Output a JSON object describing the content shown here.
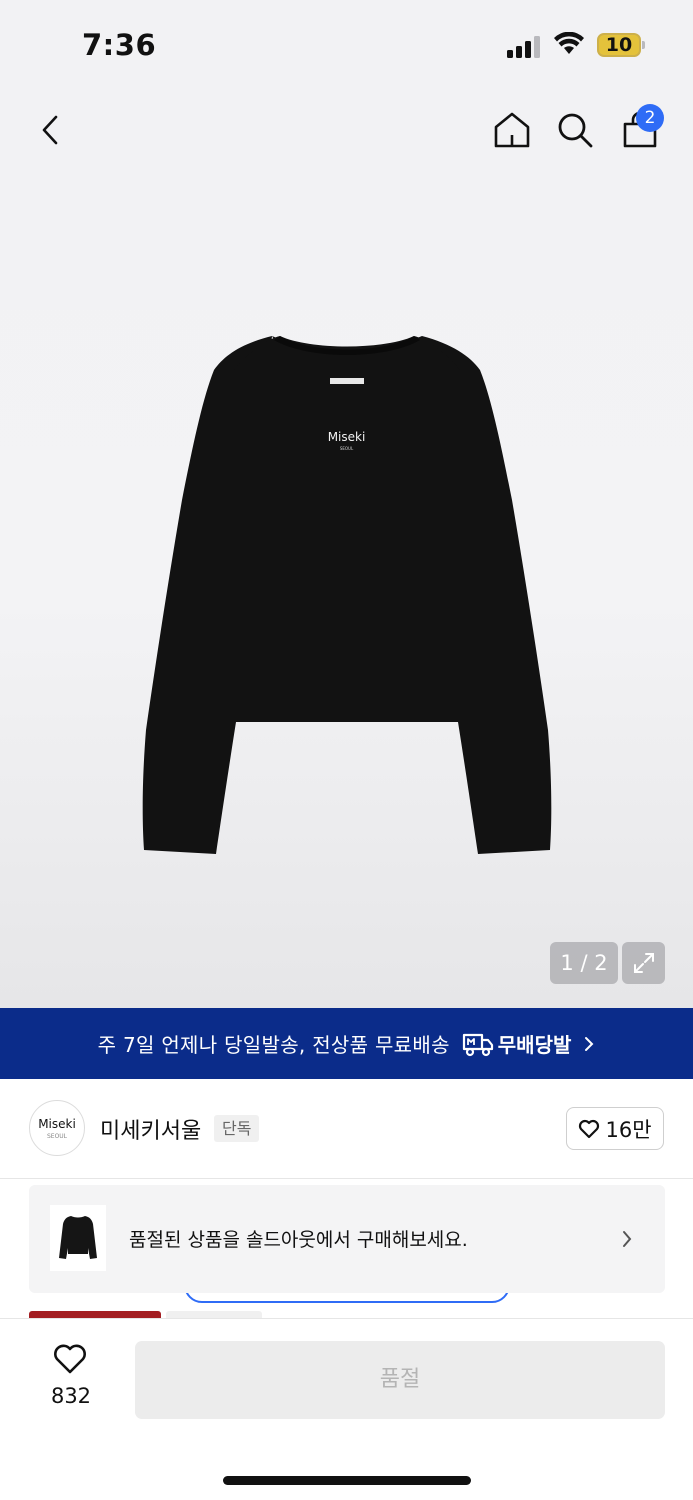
{
  "status_bar": {
    "time": "7:36",
    "battery": "10",
    "icons": [
      "signal-icon",
      "wifi-icon",
      "battery-icon"
    ]
  },
  "nav": {
    "icons": [
      "back-icon",
      "home-icon",
      "search-icon",
      "bag-icon"
    ],
    "cart_badge": "2"
  },
  "product": {
    "image_logo": "Miseki",
    "pager": "1 / 2",
    "expand_icon": "expand-icon"
  },
  "banner": {
    "text": "주 7일 언제나 당일발송, 전상품 무료배송",
    "brand": "무배당발",
    "icons": [
      "truck-icon",
      "chevron-right-icon"
    ],
    "background": "#0b2c8a"
  },
  "brand": {
    "logo_main": "Miseki",
    "logo_sub": "SEOUL",
    "name": "미세키서울",
    "tag": "단독",
    "like_count": "16만"
  },
  "soldout_card": {
    "text": "품절된 상품을 솔드아웃에서 구매해보세요."
  },
  "bottom_bar": {
    "wish_count": "832",
    "action_label": "품절"
  },
  "colors": {
    "accent_blue": "#2f6cf6",
    "badge_red": "#a31e22"
  }
}
